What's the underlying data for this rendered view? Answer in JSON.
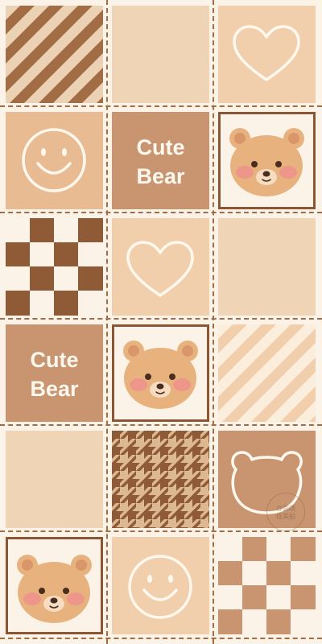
{
  "wallpaper": {
    "text_line1": "Cute",
    "text_line2": "Bear",
    "watermark": "@面颂\n佳美拍",
    "colors": {
      "cream": "#fbf3e8",
      "light_tan": "#efd4b6",
      "peach": "#f2cfac",
      "tan": "#e9bb92",
      "brown": "#c99570",
      "dark_brown": "#a26c44",
      "bear_face": "#e8b27e",
      "blush": "#f08f8f"
    },
    "tiles": [
      {
        "pattern": "diagonal-stripes",
        "icon": "none"
      },
      {
        "pattern": "plain",
        "icon": "none"
      },
      {
        "pattern": "plain",
        "icon": "heart-icon"
      },
      {
        "pattern": "plain",
        "icon": "smiley-icon"
      },
      {
        "pattern": "plain",
        "icon": "cute-bear-text"
      },
      {
        "pattern": "framed",
        "icon": "bear-face-icon"
      },
      {
        "pattern": "checkerboard",
        "icon": "none"
      },
      {
        "pattern": "plain",
        "icon": "heart-icon"
      },
      {
        "pattern": "plain",
        "icon": "none"
      },
      {
        "pattern": "plain",
        "icon": "cute-bear-text"
      },
      {
        "pattern": "framed",
        "icon": "bear-face-icon"
      },
      {
        "pattern": "diagonal-stripes",
        "icon": "none"
      },
      {
        "pattern": "plain",
        "icon": "none"
      },
      {
        "pattern": "houndstooth",
        "icon": "none"
      },
      {
        "pattern": "plain",
        "icon": "bear-outline-icon"
      },
      {
        "pattern": "framed",
        "icon": "bear-face-icon"
      },
      {
        "pattern": "plain",
        "icon": "smiley-icon"
      },
      {
        "pattern": "checkerboard",
        "icon": "none"
      }
    ]
  }
}
